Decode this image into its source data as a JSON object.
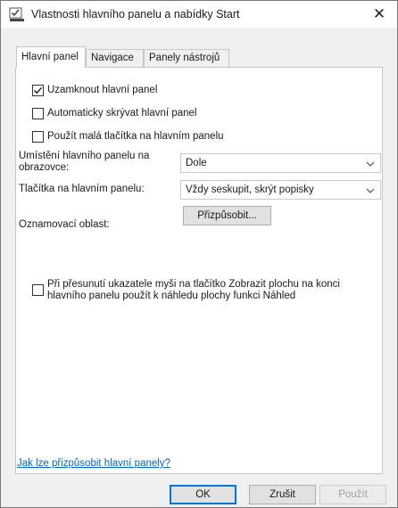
{
  "window": {
    "title": "Vlastnosti hlavního panelu a nabídky Start",
    "close_glyph": "✕",
    "icon": "taskbar-properties-icon"
  },
  "tabs": [
    {
      "label": "Hlavní panel",
      "active": true
    },
    {
      "label": "Navigace",
      "active": false
    },
    {
      "label": "Panely nástrojů",
      "active": false
    }
  ],
  "checkboxes": {
    "lock": {
      "label": "Uzamknout hlavní panel",
      "checked": true
    },
    "autohide": {
      "label": "Automaticky skrývat hlavní panel",
      "checked": false
    },
    "small_buttons": {
      "label": "Použít malá tlačítka na hlavním panelu",
      "checked": false
    },
    "peek": {
      "label": "Při přesunutí ukazatele myši na tlačítko Zobrazit plochu na konci hlavního panelu použít k náhledu plochy funkci Náhled",
      "checked": false
    }
  },
  "fields": {
    "location_label": "Umístění hlavního panelu na obrazovce:",
    "location_value": "Dole",
    "buttons_label": "Tlačítka na hlavním panelu:",
    "buttons_value": "Vždy seskupit, skrýt popisky",
    "notification_label": "Oznamovací oblast:",
    "customize_button": "Přizpůsobit..."
  },
  "help_link": "Jak lze přizpůsobit hlavní panely?",
  "footer": {
    "ok": "OK",
    "cancel": "Zrušit",
    "apply": "Použít"
  },
  "colors": {
    "link": "#0066cc",
    "accent": "#0078d7"
  }
}
